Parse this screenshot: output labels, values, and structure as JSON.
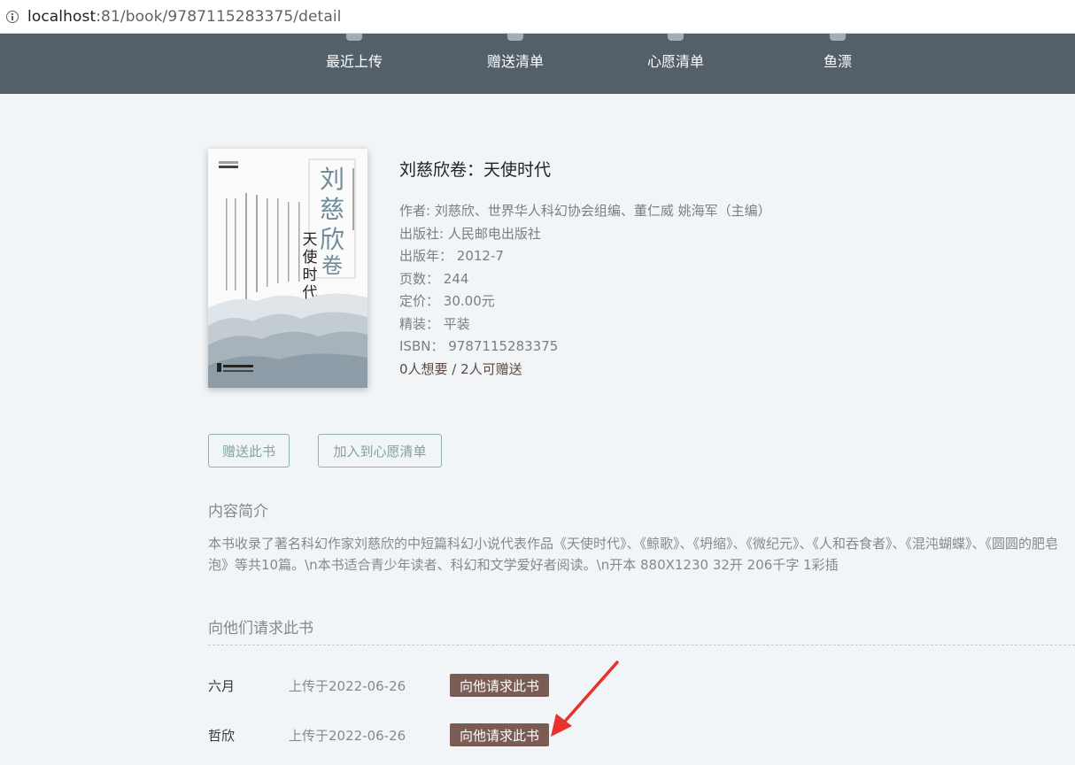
{
  "browser": {
    "url_host": "localhost",
    "url_path": ":81/book/9787115283375/detail"
  },
  "nav": {
    "items": [
      {
        "label": "最近上传",
        "icon": "upload-icon"
      },
      {
        "label": "赠送清单",
        "icon": "gift-icon"
      },
      {
        "label": "心愿清单",
        "icon": "star-icon"
      },
      {
        "label": "鱼漂",
        "icon": "bottle-icon"
      }
    ]
  },
  "book": {
    "title": "刘慈欣卷：天使时代",
    "author_label": "作者: ",
    "author": "刘慈欣、世界华人科幻协会组编、董仁威 姚海军（主编）",
    "publisher_label": "出版社: ",
    "publisher": "人民邮电出版社",
    "pubdate_label": "出版年：",
    "pubdate": "2012-7",
    "pages_label": "页数：",
    "pages": "244",
    "price_label": "定价：",
    "price": "30.00元",
    "binding_label": "精装：",
    "binding": "平装",
    "isbn_label": "ISBN：",
    "isbn": "9787115283375",
    "want_stats": "0人想要 / 2人可赠送",
    "cover": {
      "big_title": "刘慈欣卷",
      "subtitle": "天使时代",
      "series_small": "中国科幻名家获奖佳作文丛",
      "publisher_logo": "人民邮电出版社"
    }
  },
  "actions": {
    "give_label": "赠送此书",
    "wishlist_label": "加入到心愿清单"
  },
  "intro": {
    "heading": "内容简介",
    "text": "本书收录了著名科幻作家刘慈欣的中短篇科幻小说代表作品《天使时代》、《鲸歌》、《坍缩》、《微纪元》、《人和吞食者》、《混沌蝴蝶》、《圆圆的肥皂泡》等共10篇。\\n本书适合青少年读者、科幻和文学爱好者阅读。\\n开本 880X1230 32开 206千字 1彩插"
  },
  "requests": {
    "heading": "向他们请求此书",
    "rows": [
      {
        "name": "六月",
        "date": "上传于2022-06-26",
        "button": "向他请求此书"
      },
      {
        "name": "哲欣",
        "date": "上传于2022-06-26",
        "button": "向他请求此书"
      }
    ]
  },
  "colors": {
    "navbar": "#535f69",
    "request_button": "#7b5c55",
    "outline_button": "#8fb3a4",
    "annotation_arrow": "#e8322e"
  }
}
